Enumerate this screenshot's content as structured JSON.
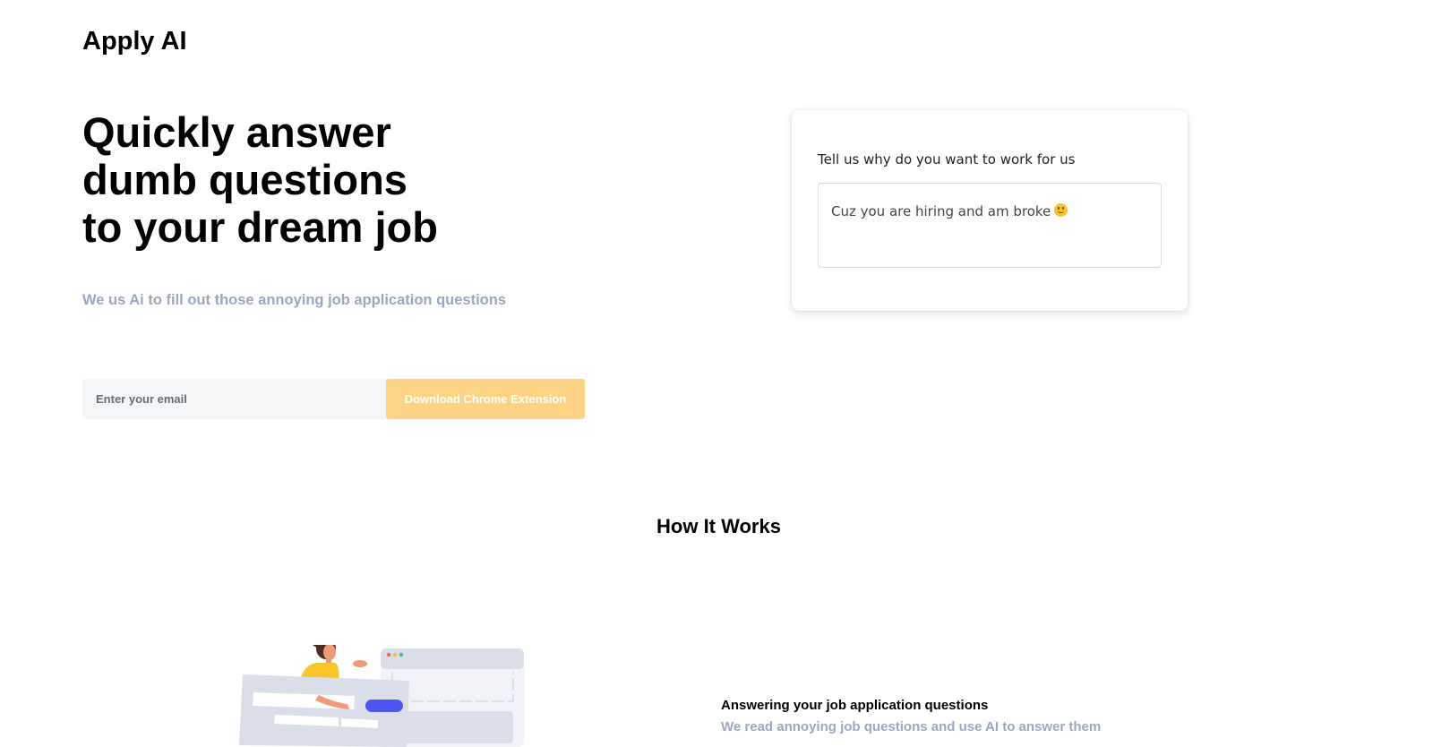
{
  "header": {
    "logo_text": "Apply AI"
  },
  "hero": {
    "title_lines": [
      "Quickly answer",
      "dumb questions",
      "to your dream job"
    ],
    "subtitle": "We us Ai to fill out those annoying job application questions",
    "email_placeholder": "Enter your email",
    "email_value": "",
    "cta_label": "Download Chrome Extension"
  },
  "demo": {
    "question": "Tell us why do you want to work for us",
    "answer": "Cuz you are hiring and am broke",
    "answer_emoji": "smiling-face-emoji"
  },
  "how_it_works": {
    "title": "How It Works",
    "features": [
      {
        "title": "Answering your job application questions",
        "description": "We read annoying job questions and use AI to answer them",
        "illustration": "person-filling-form-illustration"
      }
    ]
  },
  "colors": {
    "text": "#000000",
    "muted": "#9ba7c2",
    "cta_background": "#fdd486",
    "input_background": "#f5f6f8",
    "illustration_accent": "#4f55f1",
    "illustration_yellow": "#f7c629"
  }
}
